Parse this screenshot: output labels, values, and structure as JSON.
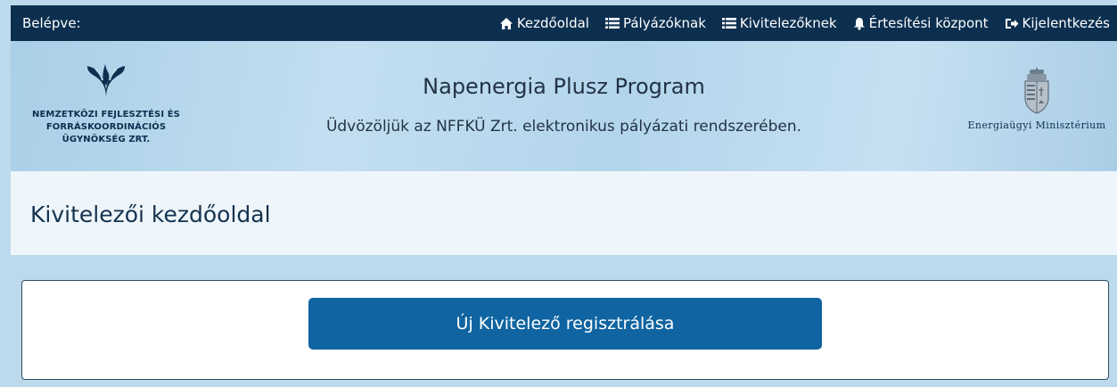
{
  "topbar": {
    "logged_in_label": "Belépve:",
    "nav": [
      {
        "label": "Kezdőoldal",
        "icon": "home-icon"
      },
      {
        "label": "Pályázóknak",
        "icon": "list-icon"
      },
      {
        "label": "Kivitelezőknek",
        "icon": "list-icon"
      },
      {
        "label": "Értesítési központ",
        "icon": "bell-icon"
      },
      {
        "label": "Kijelentkezés",
        "icon": "sign-out-icon"
      }
    ]
  },
  "header": {
    "org_name_line1": "NEMZETKÖZI FEJLESZTÉSI ÉS",
    "org_name_line2": "FORRÁSKOORDINÁCIÓS",
    "org_name_line3": "ÜGYNÖKSÉG ZRT.",
    "program_title": "Napenergia Plusz Program",
    "program_subtitle": "Üdvözöljük az NFFKÜ Zrt. elektronikus pályázati rendszerében.",
    "ministry_name": "Energiaügyi Minisztérium"
  },
  "page": {
    "title": "Kivitelezői kezdőoldal",
    "register_button": "Új Kivitelező regisztrálása"
  },
  "colors": {
    "topbar_bg": "#0d2f4f",
    "primary_button": "#0f64a1",
    "page_head_bg": "#eef6fc"
  }
}
